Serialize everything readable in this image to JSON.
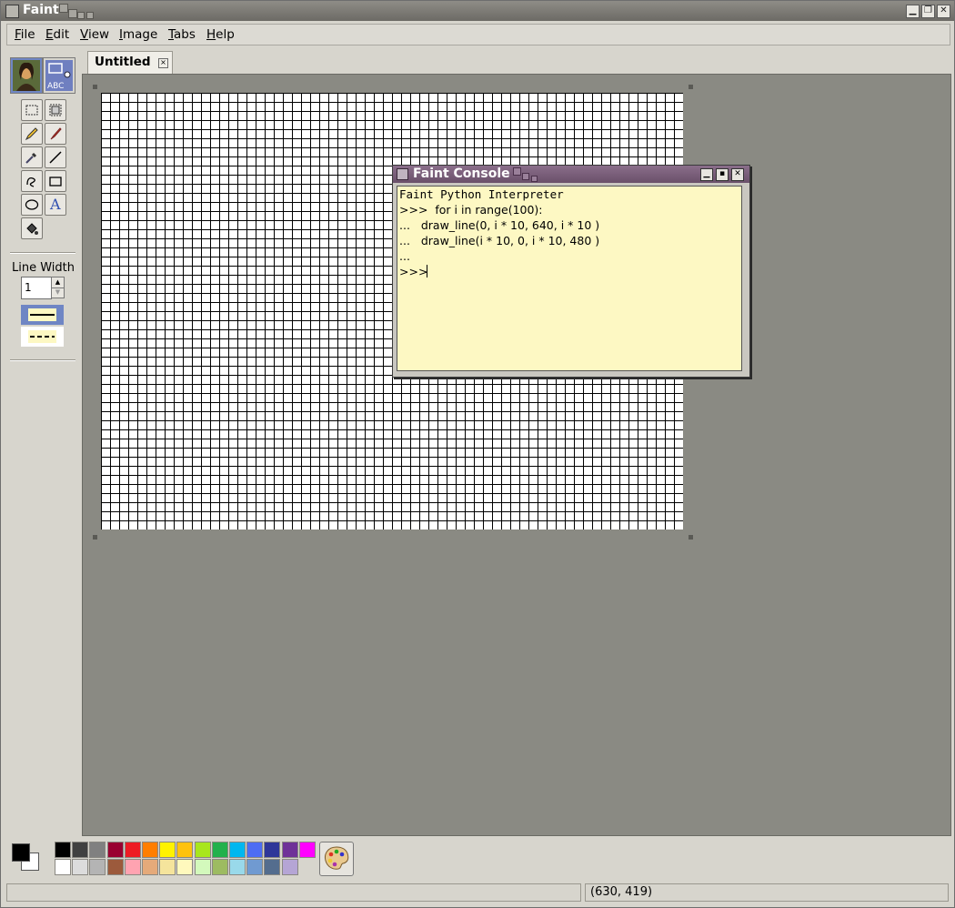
{
  "window": {
    "title": "Faint"
  },
  "menu": [
    {
      "label": "File",
      "accel": "F",
      "rest": "ile"
    },
    {
      "label": "Edit",
      "accel": "E",
      "rest": "dit"
    },
    {
      "label": "View",
      "accel": "V",
      "rest": "iew"
    },
    {
      "label": "Image",
      "accel": "I",
      "rest": "mage"
    },
    {
      "label": "Tabs",
      "accel": "T",
      "rest": "abs"
    },
    {
      "label": "Help",
      "accel": "H",
      "rest": "elp"
    }
  ],
  "toolbox": {
    "line_width_label": "Line Width",
    "line_width_value": "1",
    "text_tool_glyph": "A",
    "object_tool_text": "ABC"
  },
  "tabs": [
    {
      "label": "Untitled",
      "close": "×"
    }
  ],
  "console": {
    "title": "Faint Console",
    "lines": [
      "Faint Python Interpreter",
      ">>>  for i in range(100):",
      "...   draw_line(0, i * 10, 640, i * 10 )",
      "...   draw_line(i * 10, 0, i * 10, 480 )",
      "...",
      ">>> "
    ]
  },
  "palette": {
    "primary": "#000000",
    "secondary": "#ffffff",
    "row1": [
      "#000000",
      "#404040",
      "#808080",
      "#990030",
      "#ed1c24",
      "#ff7e00",
      "#fff200",
      "#ffc20e",
      "#a8e61d",
      "#22b14c",
      "#00b7ef",
      "#4d6df3",
      "#2f3699",
      "#6f3198",
      "#ff00ff"
    ],
    "row2": [
      "#ffffff",
      "#dcdcdc",
      "#b4b4b4",
      "#9c5a3c",
      "#ffa3b1",
      "#e5aa7a",
      "#f5e49c",
      "#fff9bd",
      "#d3f9bc",
      "#9dbb61",
      "#99d9ea",
      "#709ad1",
      "#546d8e",
      "#b5a5d5"
    ]
  },
  "status": {
    "coordinates": "(630, 419)"
  }
}
